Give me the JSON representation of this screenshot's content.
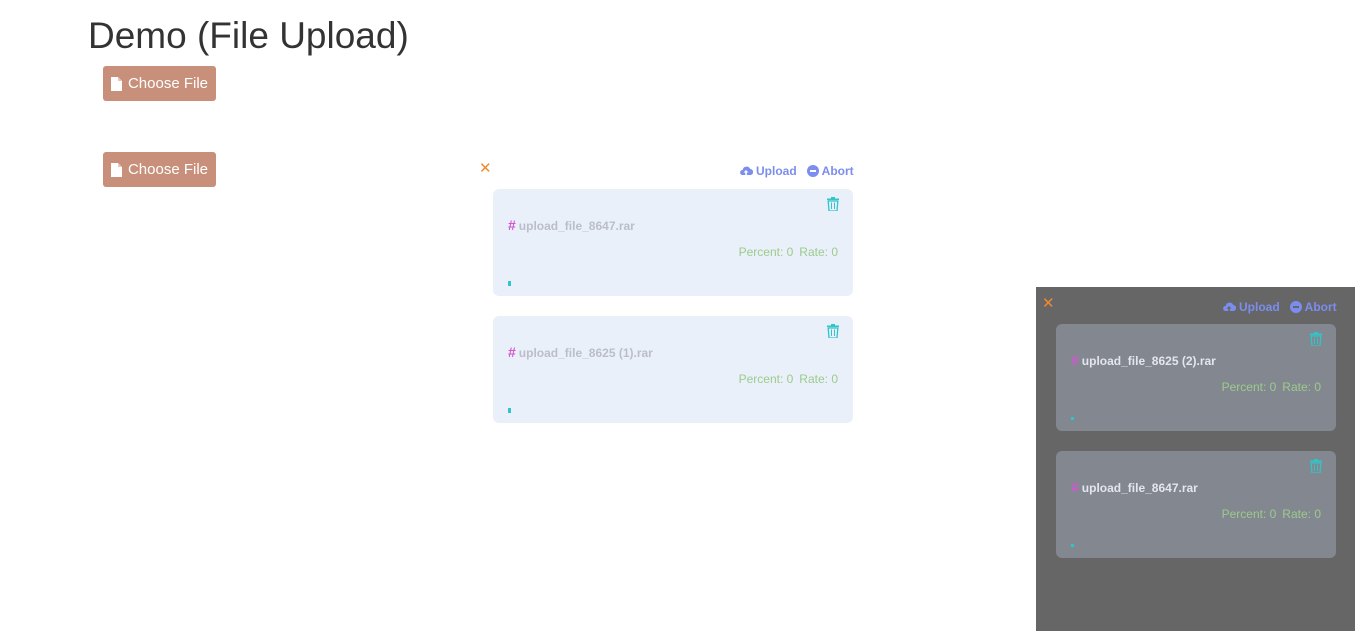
{
  "page": {
    "title": "Demo (File Upload)"
  },
  "buttons": {
    "choose_file_1": "Choose File",
    "choose_file_2": "Choose File"
  },
  "center_panel": {
    "upload_label": "Upload",
    "abort_label": "Abort",
    "files": [
      {
        "hash": "#",
        "name": "upload_file_8647.rar",
        "percent_label": "Percent: 0",
        "rate_label": "Rate: 0",
        "progress": 0
      },
      {
        "hash": "#",
        "name": "upload_file_8625 (1).rar",
        "percent_label": "Percent: 0",
        "rate_label": "Rate: 0",
        "progress": 0
      }
    ]
  },
  "float_panel": {
    "upload_label": "Upload",
    "abort_label": "Abort",
    "files": [
      {
        "hash": "#",
        "name": "upload_file_8625 (2).rar",
        "percent_label": "Percent: 0",
        "rate_label": "Rate: 0",
        "progress": 0
      },
      {
        "hash": "#",
        "name": "upload_file_8647.rar",
        "percent_label": "Percent: 0",
        "rate_label": "Rate: 0",
        "progress": 0
      }
    ]
  },
  "icons": {
    "choose": "file-icon",
    "close": "close-icon",
    "upload": "cloud-upload-icon",
    "abort": "minus-circle-icon",
    "delete": "trash-icon"
  },
  "colors": {
    "button": "#c8907a",
    "close": "#f0892e",
    "action": "#7b8dee",
    "hash": "#d455d4",
    "stats": "#9ccb8c",
    "progress": "#30c5c9",
    "card_light": "#eaf0fa",
    "card_dark": "#828790",
    "float_bg": "#666666"
  }
}
